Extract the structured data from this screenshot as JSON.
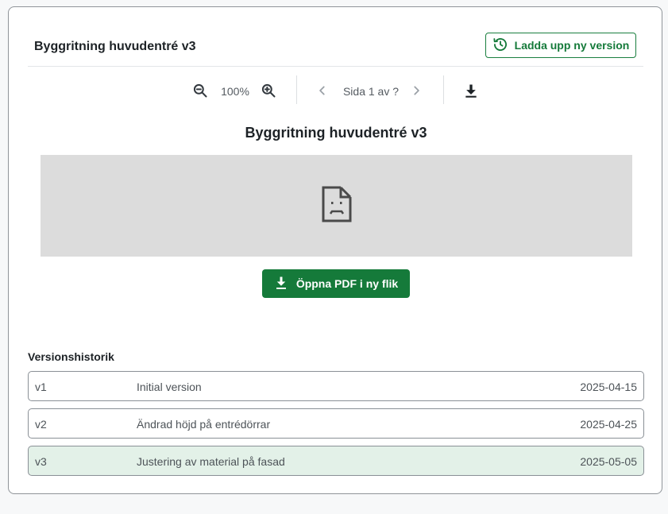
{
  "document": {
    "title": "Byggritning huvudentré v3",
    "viewer_title": "Byggritning huvudentré v3"
  },
  "header": {
    "upload_label": "Ladda upp ny version"
  },
  "toolbar": {
    "zoom_level": "100%",
    "page_text": "Sida 1 av ?"
  },
  "viewer": {
    "open_pdf_label": "Öppna PDF i ny flik"
  },
  "history": {
    "label": "Versionshistorik",
    "versions": [
      {
        "id": "v1",
        "description": "Initial version",
        "date": "2025-04-15",
        "active": false
      },
      {
        "id": "v2",
        "description": "Ändrad höjd på entrédörrar",
        "date": "2025-04-25",
        "active": false
      },
      {
        "id": "v3",
        "description": "Justering av material på fasad",
        "date": "2025-05-05",
        "active": true
      }
    ]
  },
  "colors": {
    "accent": "#157a3a",
    "active_row": "#e3f1e8",
    "placeholder_bg": "#dcdcdc"
  }
}
